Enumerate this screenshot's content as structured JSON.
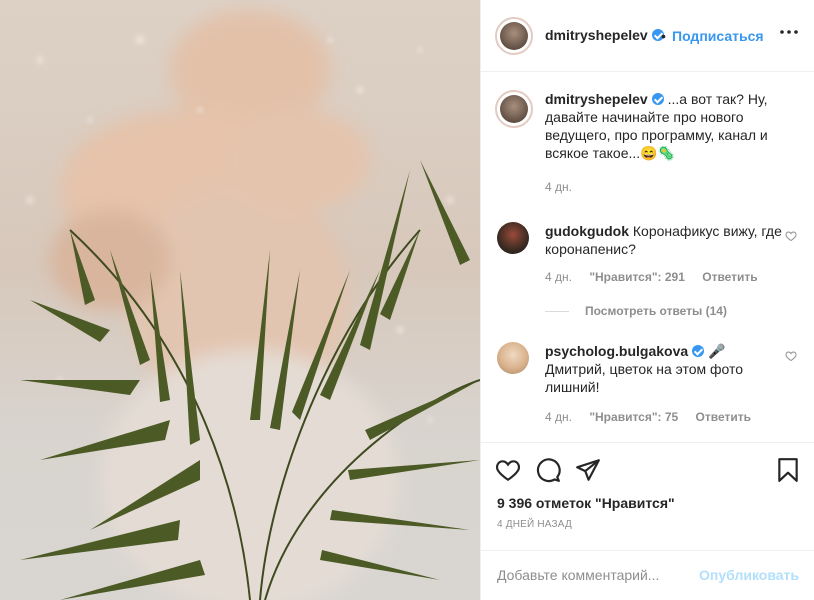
{
  "post": {
    "username": "dmitryshepelev",
    "follow_label": "Подписаться",
    "separator": "•"
  },
  "caption": {
    "username": "dmitryshepelev",
    "text": "...а вот так? Ну, давайте начинайте про нового ведущего, про программу, канал и всякое такое...😄🦠",
    "time": "4 дн."
  },
  "comments": [
    {
      "username": "gudokgudok",
      "text": "Коронафикус вижу, где коронапенис?",
      "time": "4 дн.",
      "likes": "\"Нравится\": 291",
      "reply": "Ответить",
      "view_replies": "Посмотреть ответы (14)"
    },
    {
      "username": "psycholog.bulgakova",
      "badge": "🎤",
      "text": "Дмитрий, цветок на этом фото лишний!",
      "time": "4 дн.",
      "likes": "\"Нравится\": 75",
      "reply": "Ответить"
    }
  ],
  "footer": {
    "likes": "9 396 отметок \"Нравится\"",
    "date": "4 ДНЕЙ НАЗАД",
    "comment_placeholder": "Добавьте комментарий...",
    "publish": "Опубликовать"
  },
  "icons": {
    "like": "heart-icon",
    "comment": "comment-icon",
    "share": "share-icon",
    "save": "bookmark-icon",
    "more": "more-options-icon"
  },
  "colors": {
    "accent": "#3897f0",
    "publish_disabled": "#b2dffc",
    "muted": "#8e8e8e"
  }
}
